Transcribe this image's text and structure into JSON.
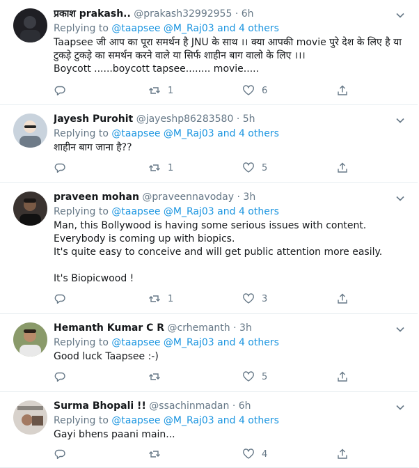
{
  "tweets": [
    {
      "name": "प्रकाश prakash..",
      "handle": "@prakash32992955",
      "dot": "·",
      "time": "6h",
      "replying_prefix": "Replying to ",
      "mention1": "@taapsee",
      "mention2": "@M_Raj03",
      "and_others": "and 4 others",
      "text": "Taapsee जी आप का पूरा समर्थन है JNU के साथ ।। क्या आपकी movie पुरे देश के लिए है या टुकड़े टुकड़े का समर्थन करने वाले या सिर्फ शाहीन बाग वालो के लिए ।।।\nBoycott ......boycott tapsee........ movie.....",
      "reply_count": "",
      "retweet_count": "1",
      "like_count": "6",
      "avatar_color": "#1f1f24"
    },
    {
      "name": "Jayesh Purohit",
      "handle": "@jayeshp86283580",
      "dot": "·",
      "time": "5h",
      "replying_prefix": "Replying to ",
      "mention1": "@taapsee",
      "mention2": "@M_Raj03",
      "and_others": "and 4 others",
      "text": "शाहीन बाग जाना है??",
      "reply_count": "",
      "retweet_count": "1",
      "like_count": "5",
      "avatar_color": "#c9d3dd"
    },
    {
      "name": "praveen mohan",
      "handle": "@praveennavoday",
      "dot": "·",
      "time": "3h",
      "replying_prefix": "Replying to ",
      "mention1": "@taapsee",
      "mention2": "@M_Raj03",
      "and_others": "and 4 others",
      "text": "Man, this Bollywood is having some serious issues with content.\nEverybody is coming up with biopics.\nIt's quite easy to conceive and will get public attention more easily.\n\nIt's Biopicwood !",
      "reply_count": "",
      "retweet_count": "1",
      "like_count": "3",
      "avatar_color": "#3a3330"
    },
    {
      "name": "Hemanth Kumar C R",
      "handle": "@crhemanth",
      "dot": "·",
      "time": "3h",
      "replying_prefix": "Replying to ",
      "mention1": "@taapsee",
      "mention2": "@M_Raj03",
      "and_others": "and 4 others",
      "text": "Good luck Taapsee :-)",
      "reply_count": "",
      "retweet_count": "",
      "like_count": "5",
      "avatar_color": "#8a9a6a"
    },
    {
      "name": "Surma Bhopali !!",
      "handle": "@ssachinmadan",
      "dot": "·",
      "time": "6h",
      "replying_prefix": "Replying to ",
      "mention1": "@taapsee",
      "mention2": "@M_Raj03",
      "and_others": "and 4 others",
      "text": "Gayi bhens paani main...",
      "reply_count": "",
      "retweet_count": "",
      "like_count": "4",
      "avatar_color": "#d8d2cc"
    }
  ],
  "icons": {
    "reply": "reply-icon",
    "retweet": "retweet-icon",
    "like": "heart-icon",
    "share": "share-icon",
    "caret": "chevron-down-icon"
  },
  "colors": {
    "link": "#1b95e0",
    "muted": "#657786",
    "border": "#e6ecf0"
  }
}
